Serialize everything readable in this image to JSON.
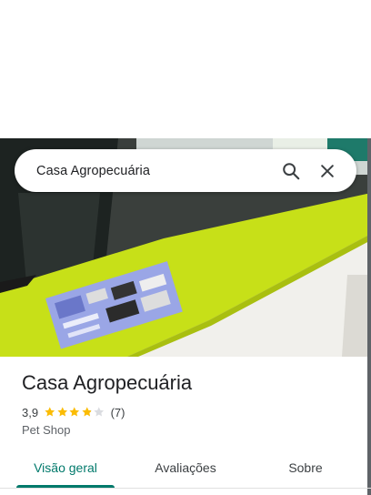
{
  "search": {
    "query": "Casa Agropecuária"
  },
  "icons": {
    "search": "search-icon",
    "close": "close-icon",
    "star": "star-icon"
  },
  "place": {
    "name": "Casa Agropecuária",
    "rating": "3,9",
    "rating_value": 3.9,
    "reviews": "(7)",
    "category": "Pet Shop"
  },
  "tabs": [
    {
      "label": "Visão geral"
    },
    {
      "label": "Avaliações"
    },
    {
      "label": "Sobre"
    }
  ],
  "colors": {
    "accent": "#00796b",
    "star": "#fbbc04",
    "star_empty": "#dadce0"
  }
}
